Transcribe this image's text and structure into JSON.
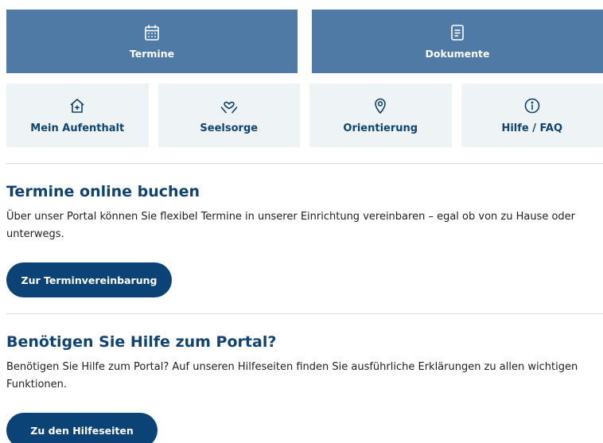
{
  "primary_tiles": [
    {
      "label": "Termine",
      "icon": "calendar-icon"
    },
    {
      "label": "Dokumente",
      "icon": "document-icon"
    }
  ],
  "secondary_tiles": [
    {
      "label": "Mein Aufenthalt",
      "icon": "house-plus-icon"
    },
    {
      "label": "Seelsorge",
      "icon": "hands-heart-icon"
    },
    {
      "label": "Orientierung",
      "icon": "map-pin-icon"
    },
    {
      "label": "Hilfe / FAQ",
      "icon": "info-icon"
    }
  ],
  "sections": [
    {
      "title": "Termine online buchen",
      "text": "Über unser Portal können Sie flexibel Termine in unserer Einrichtung vereinbaren – egal ob von zu Hause oder unterwegs.",
      "button": "Zur Terminvereinbarung"
    },
    {
      "title": "Benötigen Sie Hilfe zum Portal?",
      "text": "Benötigen Sie Hilfe zum Portal? Auf unseren Hilfeseiten finden Sie ausführliche Erklärungen zu allen wichtigen Funktionen.",
      "button": "Zu den Hilfeseiten"
    }
  ],
  "colors": {
    "primary_tile_bg": "#4e7aa5",
    "secondary_tile_bg": "#eef3f5",
    "brand_dark": "#0b4376",
    "heading": "#0f4373"
  }
}
